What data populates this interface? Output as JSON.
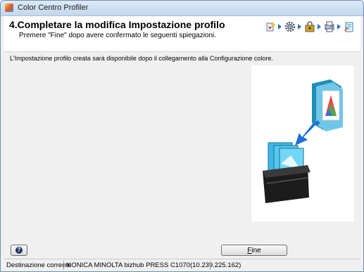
{
  "window": {
    "title": "Color Centro Profiler"
  },
  "header": {
    "step_title": "4.Completare la modifica Impostazione profilo",
    "step_subtitle": "Premere \"Fine\" dopo avere confermato le seguenti spiegazioni."
  },
  "wizard_steps": [
    "create-profile-icon",
    "gear-icon",
    "lock-icon",
    "printer-icon",
    "profile-edit-icon"
  ],
  "main": {
    "info_text": "L'Impostazione profilo creata sarà disponibile dopo il collegamento alla Configurazione colore."
  },
  "buttons": {
    "fine_prefix": "F",
    "fine_rest": "ine",
    "help": "?"
  },
  "status": {
    "label": "Destinazione corrente",
    "value": "KONICA MINOLTA bizhub PRESS C1070(10.239.225.162)"
  },
  "colors": {
    "accent": "#2f6fc2",
    "title_bg": "#c3d7ec"
  }
}
